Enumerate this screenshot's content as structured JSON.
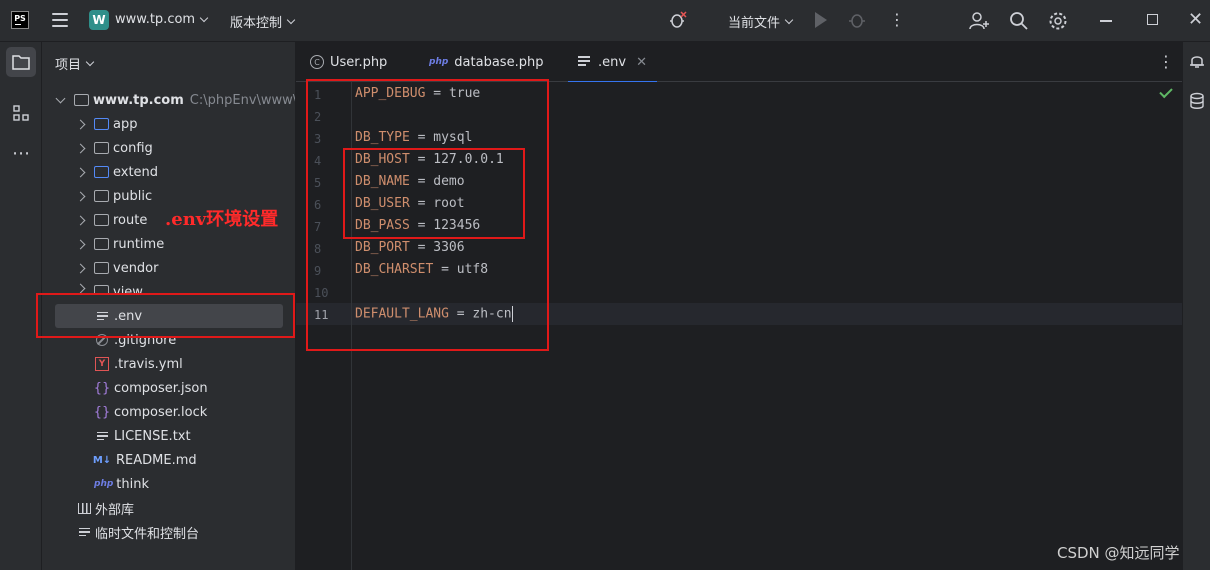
{
  "titlebar": {
    "logo": "PS",
    "project_badge": "W",
    "project_name": "www.tp.com",
    "vcs": "版本控制",
    "run_config": "当前文件"
  },
  "project_panel": {
    "header": "项目",
    "root": {
      "name": "www.tp.com",
      "path": "C:\\phpEnv\\www\\w"
    },
    "folders": [
      "app",
      "config",
      "extend",
      "public",
      "route",
      "runtime",
      "vendor",
      "view"
    ],
    "files": [
      ".env",
      ".gitignore",
      ".travis.yml",
      "composer.json",
      "composer.lock",
      "LICENSE.txt",
      "README.md",
      "think"
    ],
    "external_libraries": "外部库",
    "scratches": "临时文件和控制台"
  },
  "tabs": [
    {
      "label": "User.php",
      "icon": "class-icon"
    },
    {
      "label": "database.php",
      "icon": "php-icon"
    },
    {
      "label": ".env",
      "icon": "text-file-icon",
      "active": true
    }
  ],
  "editor": {
    "lines": [
      {
        "n": "1",
        "key": "APP_DEBUG",
        "value": "true"
      },
      {
        "n": "2",
        "key": "",
        "value": ""
      },
      {
        "n": "3",
        "key": "DB_TYPE",
        "value": "mysql"
      },
      {
        "n": "4",
        "key": "DB_HOST",
        "value": "127.0.0.1"
      },
      {
        "n": "5",
        "key": "DB_NAME",
        "value": "demo"
      },
      {
        "n": "6",
        "key": "DB_USER",
        "value": "root"
      },
      {
        "n": "7",
        "key": "DB_PASS",
        "value": "123456"
      },
      {
        "n": "8",
        "key": "DB_PORT",
        "value": "3306"
      },
      {
        "n": "9",
        "key": "DB_CHARSET",
        "value": "utf8"
      },
      {
        "n": "10",
        "key": "",
        "value": ""
      },
      {
        "n": "11",
        "key": "DEFAULT_LANG",
        "value": "zh-cn"
      }
    ]
  },
  "annotation": ".env环境设置",
  "watermark": "CSDN @知远同学",
  "colors": {
    "accent": "#3574f0",
    "annotation_red": "#e01919",
    "key_orange": "#cf8e6d"
  }
}
